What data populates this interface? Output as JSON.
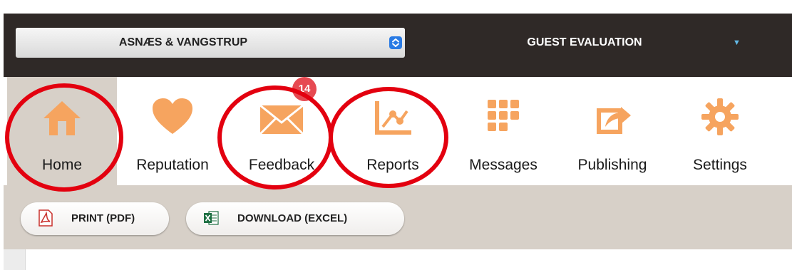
{
  "header": {
    "hotel_select_value": "ASNÆS & VANGSTRUP",
    "module_label": "GUEST EVALUATION"
  },
  "nav": {
    "items": [
      {
        "label": "Home",
        "icon": "house-icon",
        "active": true
      },
      {
        "label": "Reputation",
        "icon": "heart-icon"
      },
      {
        "label": "Feedback",
        "icon": "envelope-icon",
        "badge": "14"
      },
      {
        "label": "Reports",
        "icon": "line-chart-icon"
      },
      {
        "label": "Messages",
        "icon": "grid-icon"
      },
      {
        "label": "Publishing",
        "icon": "share-icon"
      },
      {
        "label": "Settings",
        "icon": "gear-icon"
      }
    ]
  },
  "toolbar": {
    "print_label": "PRINT (PDF)",
    "download_label": "DOWNLOAD (EXCEL)"
  },
  "colors": {
    "icon_orange": "#f6a45f",
    "header_dark": "#2f2927",
    "active_tab_bg": "#d7d0c8",
    "badge_red": "#e64a52",
    "annotation_red": "#e3000f"
  }
}
